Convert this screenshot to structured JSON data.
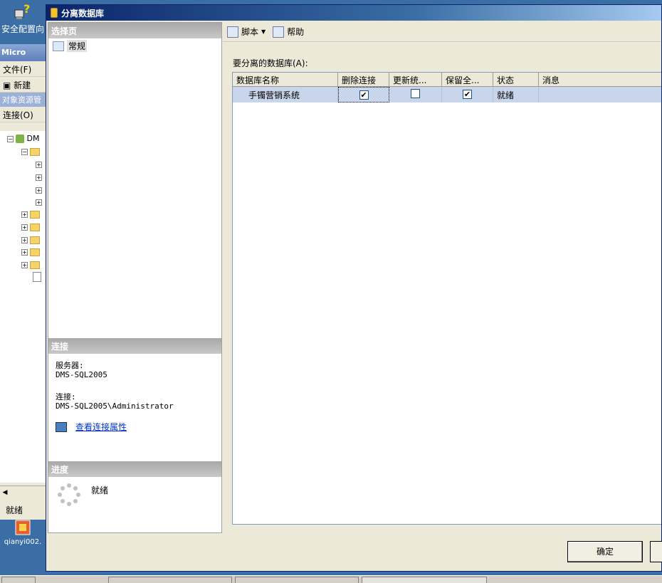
{
  "desktop": {
    "icon1_label": "安全配置向",
    "icon2_label": "qianyi002."
  },
  "bg_window": {
    "title": "Micro",
    "menu_file": "文件(F)",
    "toolbar_new": "新建",
    "oe_header": "对象资源管",
    "connect": "连接(O)",
    "root_node": "DM",
    "status": "就绪"
  },
  "dialog": {
    "title": "分离数据库",
    "select_page_header": "选择页",
    "pages": [
      "常规"
    ],
    "connection_header": "连接",
    "server_label": "服务器:",
    "server_value": "DMS-SQL2005",
    "connection_label": "连接:",
    "connection_value": "DMS-SQL2005\\Administrator",
    "view_props_link": "查看连接属性",
    "progress_header": "进度",
    "progress_status": "就绪",
    "toolbar": {
      "script": "脚本",
      "help": "帮助"
    },
    "grid_label": "要分离的数据库(A):",
    "columns": [
      "数据库名称",
      "删除连接",
      "更新统...",
      "保留全...",
      "状态",
      "消息"
    ],
    "rows": [
      {
        "name": "手镯营销系统",
        "drop_connections": true,
        "update_stats": false,
        "keep_fulltext": true,
        "status": "就绪",
        "message": ""
      }
    ],
    "ok_button": "确定"
  },
  "colors": {
    "title_bar": "#0a246a",
    "grid_row_selected": "#c9d5ea",
    "desktop": "#3a6ea5"
  }
}
